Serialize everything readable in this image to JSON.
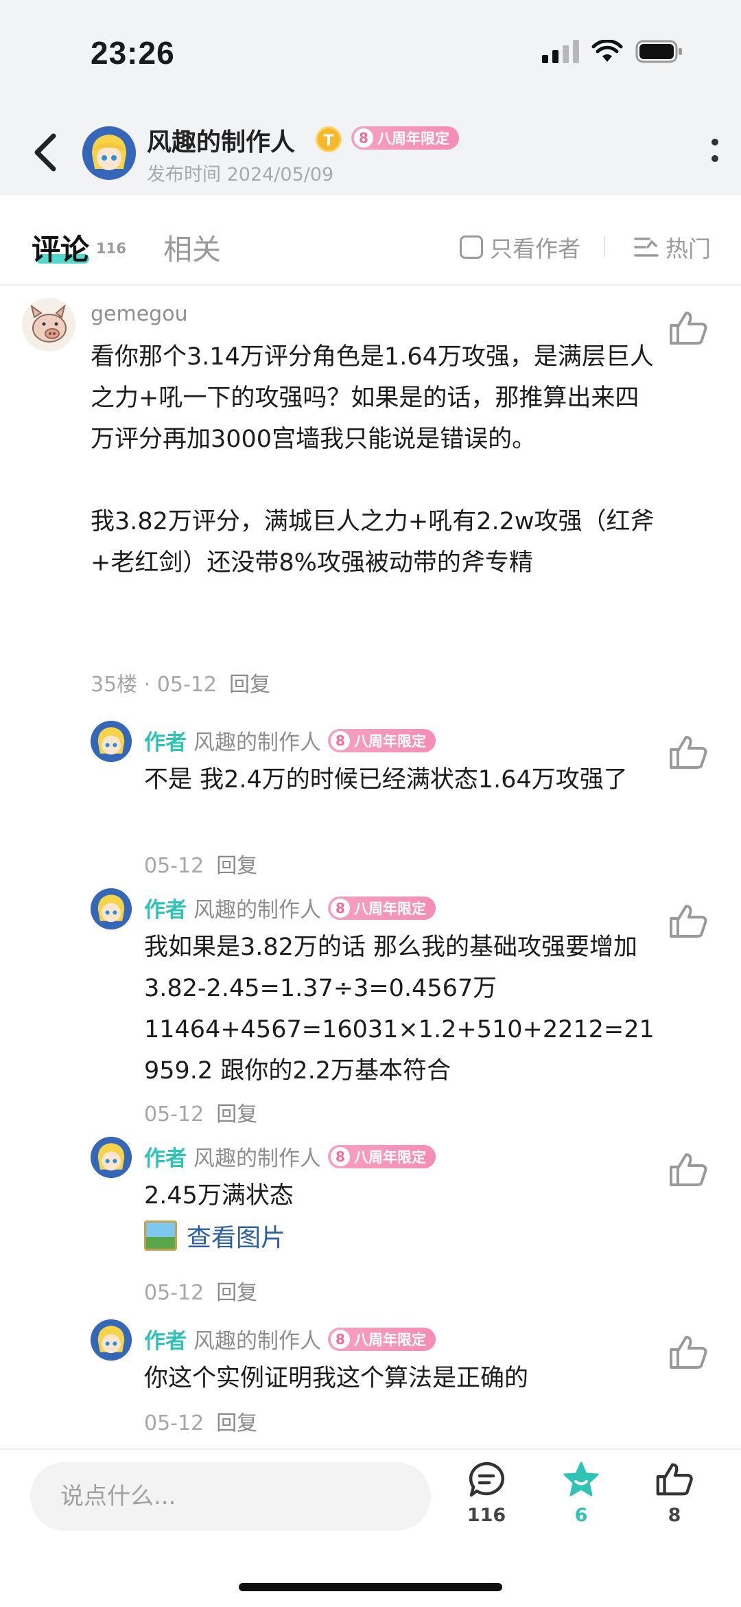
{
  "status_bar": {
    "time": "23:26"
  },
  "header": {
    "author_name": "风趣的制作人",
    "coin_badge": "T",
    "anniversary_badge": {
      "num": "8",
      "label": "八周年限定"
    },
    "publish_date": "发布时间 2024/05/09"
  },
  "tabs": {
    "comments_label": "评论",
    "comments_count": "116",
    "related_label": "相关",
    "only_author_label": "只看作者",
    "sort_label": "热门"
  },
  "main_comment": {
    "username": "gemegou",
    "text": "看你那个3.14万评分角色是1.64万攻强，是满层巨人之力+吼一下的攻强吗？如果是的话，那推算出来四万评分再加3000宫墙我只能说是错误的。\n\n我3.82万评分，满城巨人之力+吼有2.2w攻强（红斧+老红剑）还没带8%攻强被动带的斧专精",
    "floor_date": "35楼 · 05-12",
    "reply_label": "回复"
  },
  "replies": [
    {
      "tag": "作者",
      "name": "风趣的制作人",
      "badge": "八周年限定",
      "badge_num": "8",
      "text": "不是 我2.4万的时候已经满状态1.64万攻强了",
      "date": "05-12",
      "reply_label": "回复"
    },
    {
      "tag": "作者",
      "name": "风趣的制作人",
      "badge": "八周年限定",
      "badge_num": "8",
      "text": "我如果是3.82万的话 那么我的基础攻强要增加3.82-2.45=1.37÷3=0.4567万\n11464+4567=16031×1.2+510+2212=21959.2 跟你的2.2万基本符合",
      "date": "05-12",
      "reply_label": "回复"
    },
    {
      "tag": "作者",
      "name": "风趣的制作人",
      "badge": "八周年限定",
      "badge_num": "8",
      "text": "2.45万满状态",
      "view_pic": "查看图片",
      "date": "05-12",
      "reply_label": "回复"
    },
    {
      "tag": "作者",
      "name": "风趣的制作人",
      "badge": "八周年限定",
      "badge_num": "8",
      "text": "你这个实例证明我这个算法是正确的",
      "date": "05-12",
      "reply_label": "回复"
    }
  ],
  "bottom_bar": {
    "input_placeholder": "说点什么...",
    "comment_count": "116",
    "favorite_count": "6",
    "like_count": "8"
  },
  "colors": {
    "accent": "#2ec3b4",
    "link": "#2b5ea7",
    "badge_pink": "#f48db5"
  }
}
